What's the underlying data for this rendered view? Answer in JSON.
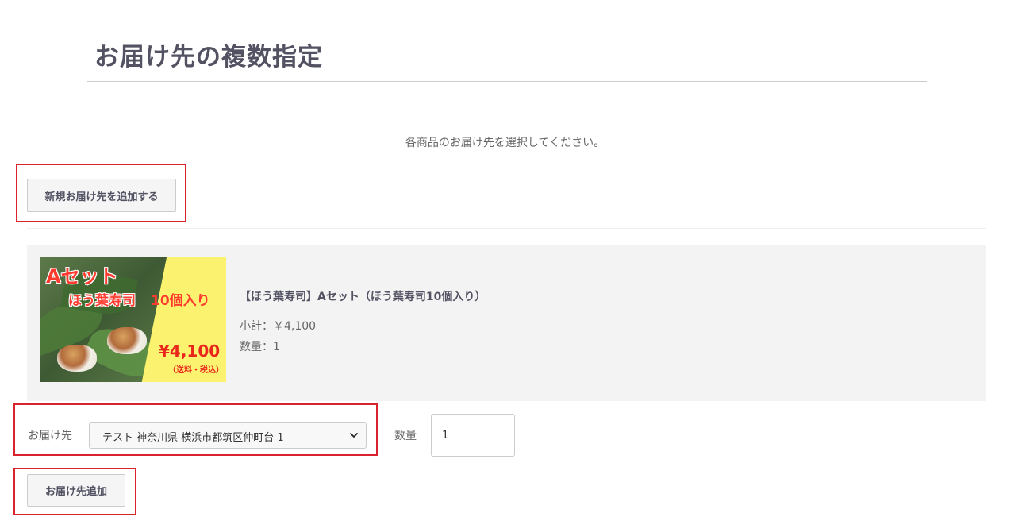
{
  "page": {
    "title": "お届け先の複数指定",
    "instruction": "各商品のお届け先を選択してください。"
  },
  "buttons": {
    "new_address_label": "新規お届け先を追加する",
    "add_destination_label": "お届け先追加"
  },
  "item": {
    "name": "【ほう葉寿司】Aセット（ほう葉寿司10個入り）",
    "subtotal": "小計：￥4,100",
    "quantity": "数量：1",
    "thumbnail": {
      "set_text": "Aセット",
      "product_text": "ほう葉寿司",
      "count_text": "10個入り",
      "price_text": "¥4,100",
      "note_text": "（送料・税込）"
    }
  },
  "destination": {
    "label": "お届け先",
    "selected_value": "テスト 神奈川県 横浜市都筑区仲町台 1",
    "quantity_label": "数量",
    "quantity_value": "1"
  },
  "colors": {
    "highlight": "#d9232d",
    "text": "#525263",
    "item_background": "#f3f3f3",
    "button_background": "#f5f5f5"
  }
}
